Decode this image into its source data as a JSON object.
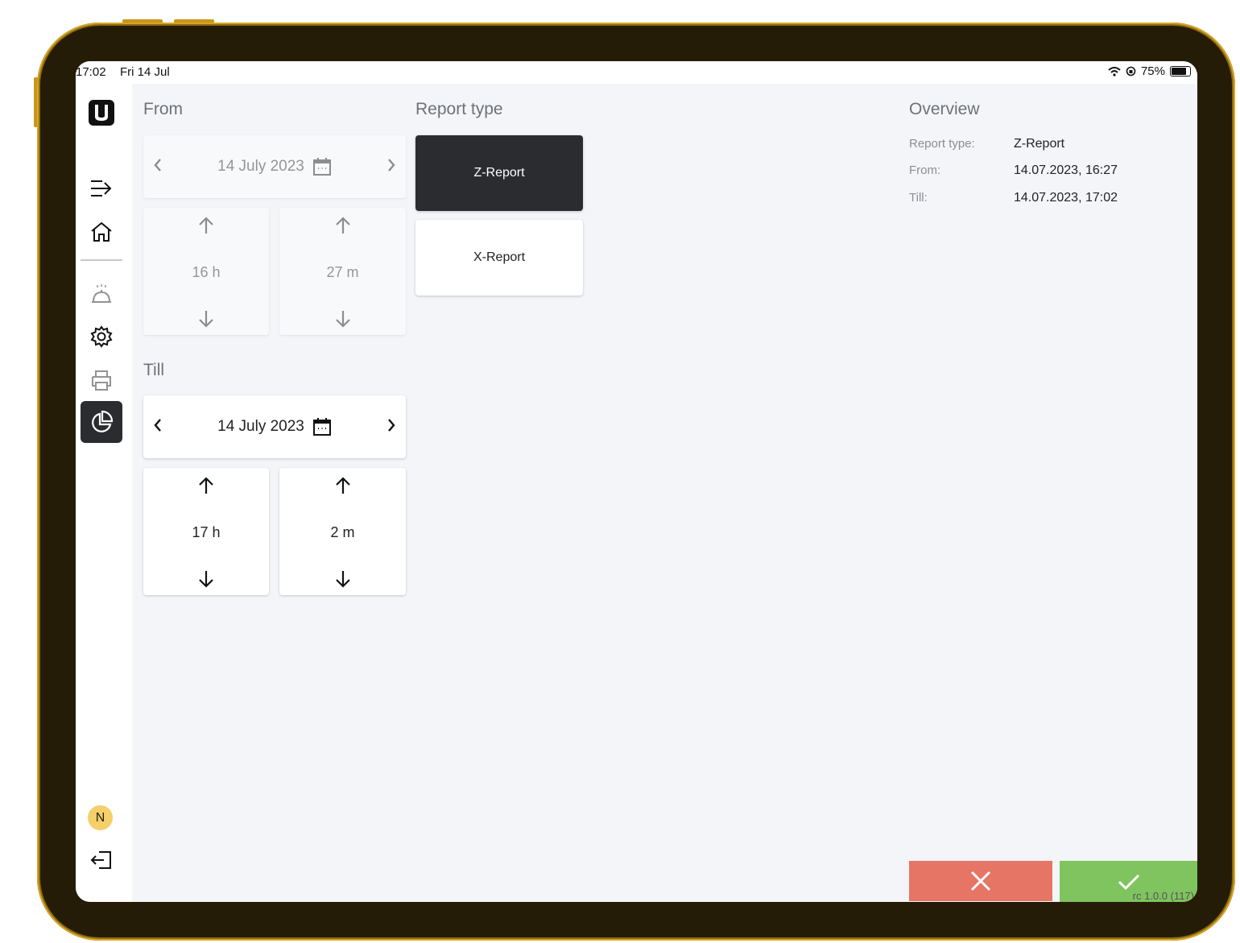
{
  "statusbar": {
    "time": "17:02",
    "date": "Fri 14 Jul",
    "battery": "75%"
  },
  "sidebar": {
    "items": [
      {
        "name": "menu-toggle",
        "icon": "collapse-menu-icon"
      },
      {
        "name": "home",
        "icon": "home-icon"
      },
      {
        "name": "kitchen",
        "icon": "cloche-icon"
      },
      {
        "name": "settings",
        "icon": "gear-icon"
      },
      {
        "name": "printer",
        "icon": "printer-icon"
      },
      {
        "name": "reports",
        "icon": "pie-chart-icon",
        "active": true
      }
    ],
    "user_initial": "N",
    "logout_icon": "logout-icon"
  },
  "from": {
    "title": "From",
    "date": "14 July 2023",
    "hours": "16 h",
    "minutes": "27 m"
  },
  "till": {
    "title": "Till",
    "date": "14 July 2023",
    "hours": "17 h",
    "minutes": "2 m"
  },
  "report_type": {
    "title": "Report type",
    "options": [
      "Z-Report",
      "X-Report"
    ],
    "selected": "Z-Report"
  },
  "overview": {
    "title": "Overview",
    "rows": [
      {
        "label": "Report type:",
        "value": "Z-Report"
      },
      {
        "label": "From:",
        "value": "14.07.2023, 16:27"
      },
      {
        "label": "Till:",
        "value": "14.07.2023, 17:02"
      }
    ]
  },
  "actions": {
    "cancel_icon": "close-icon",
    "confirm_icon": "check-icon"
  },
  "version": "rc 1.0.0 (117)",
  "colors": {
    "accent_dark": "#2b2c30",
    "cancel": "#e67565",
    "confirm": "#7fc45e",
    "avatar": "#f4cf6a"
  }
}
